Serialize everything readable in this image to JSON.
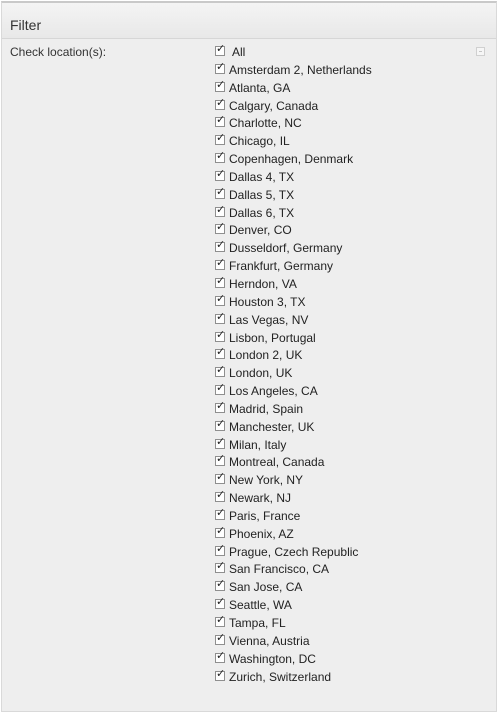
{
  "panel": {
    "title": "Filter",
    "field_label": "Check location(s):"
  },
  "locations": [
    {
      "label": "All",
      "checked": true
    },
    {
      "label": "Amsterdam 2, Netherlands",
      "checked": true
    },
    {
      "label": "Atlanta, GA",
      "checked": true
    },
    {
      "label": "Calgary, Canada",
      "checked": true
    },
    {
      "label": "Charlotte, NC",
      "checked": true
    },
    {
      "label": "Chicago, IL",
      "checked": true
    },
    {
      "label": "Copenhagen, Denmark",
      "checked": true
    },
    {
      "label": "Dallas 4, TX",
      "checked": true
    },
    {
      "label": "Dallas 5, TX",
      "checked": true
    },
    {
      "label": "Dallas 6, TX",
      "checked": true
    },
    {
      "label": "Denver, CO",
      "checked": true
    },
    {
      "label": "Dusseldorf, Germany",
      "checked": true
    },
    {
      "label": "Frankfurt, Germany",
      "checked": true
    },
    {
      "label": "Herndon, VA",
      "checked": true
    },
    {
      "label": "Houston 3, TX",
      "checked": true
    },
    {
      "label": "Las Vegas, NV",
      "checked": true
    },
    {
      "label": "Lisbon, Portugal",
      "checked": true
    },
    {
      "label": "London 2, UK",
      "checked": true
    },
    {
      "label": "London, UK",
      "checked": true
    },
    {
      "label": "Los Angeles, CA",
      "checked": true
    },
    {
      "label": "Madrid, Spain",
      "checked": true
    },
    {
      "label": "Manchester, UK",
      "checked": true
    },
    {
      "label": "Milan, Italy",
      "checked": true
    },
    {
      "label": "Montreal, Canada",
      "checked": true
    },
    {
      "label": "New York, NY",
      "checked": true
    },
    {
      "label": "Newark, NJ",
      "checked": true
    },
    {
      "label": "Paris, France",
      "checked": true
    },
    {
      "label": "Phoenix, AZ",
      "checked": true
    },
    {
      "label": "Prague, Czech Republic",
      "checked": true
    },
    {
      "label": "San Francisco, CA",
      "checked": true
    },
    {
      "label": "San Jose, CA",
      "checked": true
    },
    {
      "label": "Seattle, WA",
      "checked": true
    },
    {
      "label": "Tampa, FL",
      "checked": true
    },
    {
      "label": "Vienna, Austria",
      "checked": true
    },
    {
      "label": "Washington, DC",
      "checked": true
    },
    {
      "label": "Zurich, Switzerland",
      "checked": true
    }
  ]
}
